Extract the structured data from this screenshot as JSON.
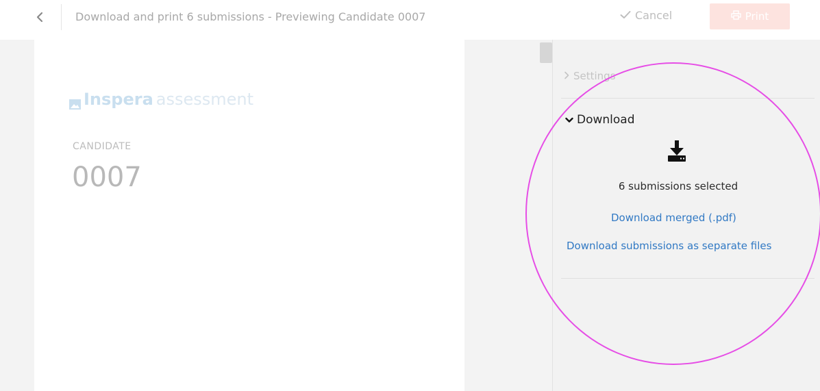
{
  "header": {
    "title": "Download and print 6 submissions - Previewing Candidate 0007",
    "cancel_label": "Cancel",
    "print_label": "Print"
  },
  "preview": {
    "logo_brand": "Inspera",
    "logo_suffix": "assessment",
    "candidate_label": "CANDIDATE",
    "candidate_number": "0007"
  },
  "panel": {
    "settings_label": "Settings",
    "download_label": "Download",
    "selected_text": "6 submissions selected",
    "link_merged": "Download merged (.pdf)",
    "link_separate": "Download submissions as separate files"
  },
  "icons": {
    "back": "chevron-left-icon",
    "cancel": "checkmark-icon",
    "print": "printer-icon",
    "settings": "chevron-right-icon",
    "download_toggle": "chevron-down-icon",
    "download": "download-tray-icon"
  },
  "colors": {
    "link": "#3179c4",
    "print_button": "#fde3df",
    "highlight": "#e64de6",
    "logo": "#c9dfef"
  }
}
